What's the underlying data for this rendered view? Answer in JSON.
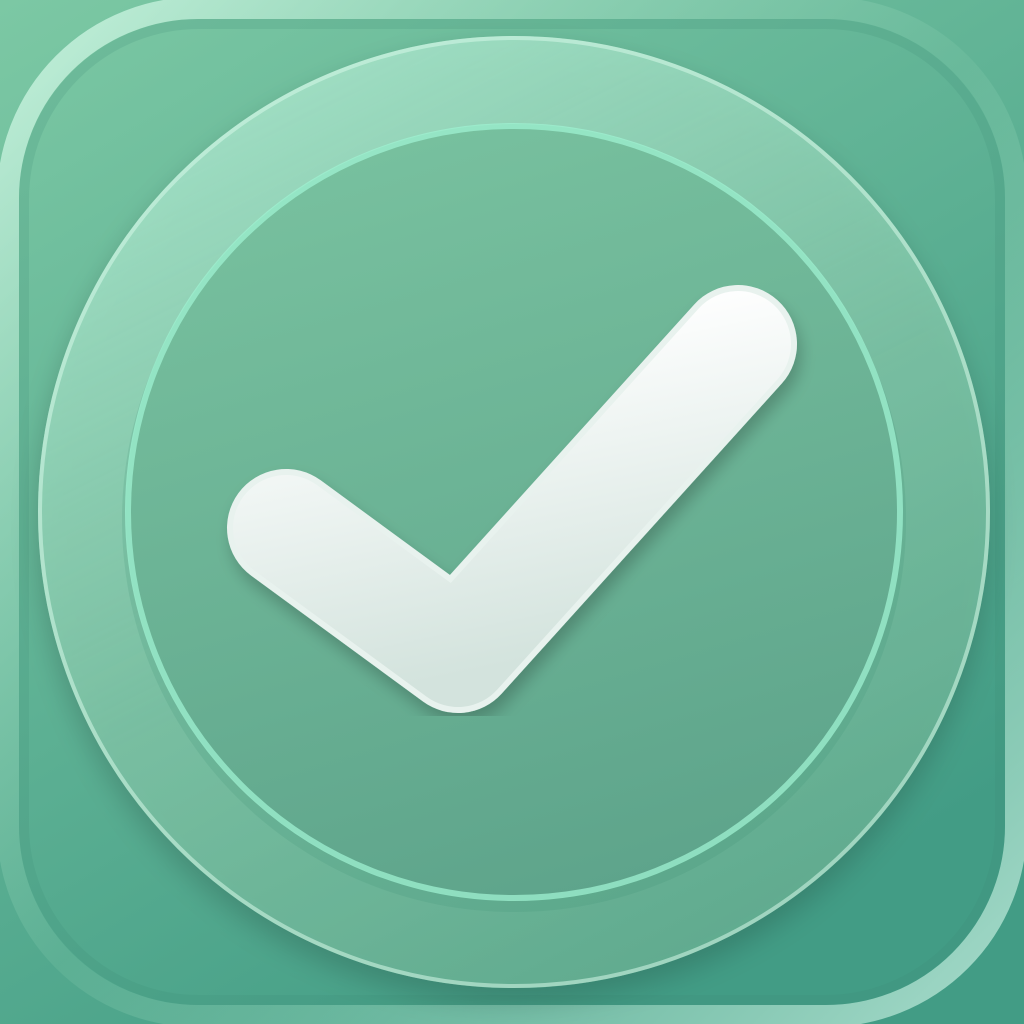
{
  "app_icon": {
    "icon_name": "checkmark-icon",
    "shape": "rounded-square",
    "colors": {
      "tile_light": "#7cc8a4",
      "tile_dark": "#429c85",
      "tile_rim": "#b8ecd6",
      "ring_outer": "#a6e3c9",
      "ring_inner_edge": "#9ff2d2",
      "disc_top": "#78c19f",
      "disc_bottom": "#5ea48b",
      "check_top": "#ffffff",
      "check_bottom": "#d3e3dd"
    }
  }
}
